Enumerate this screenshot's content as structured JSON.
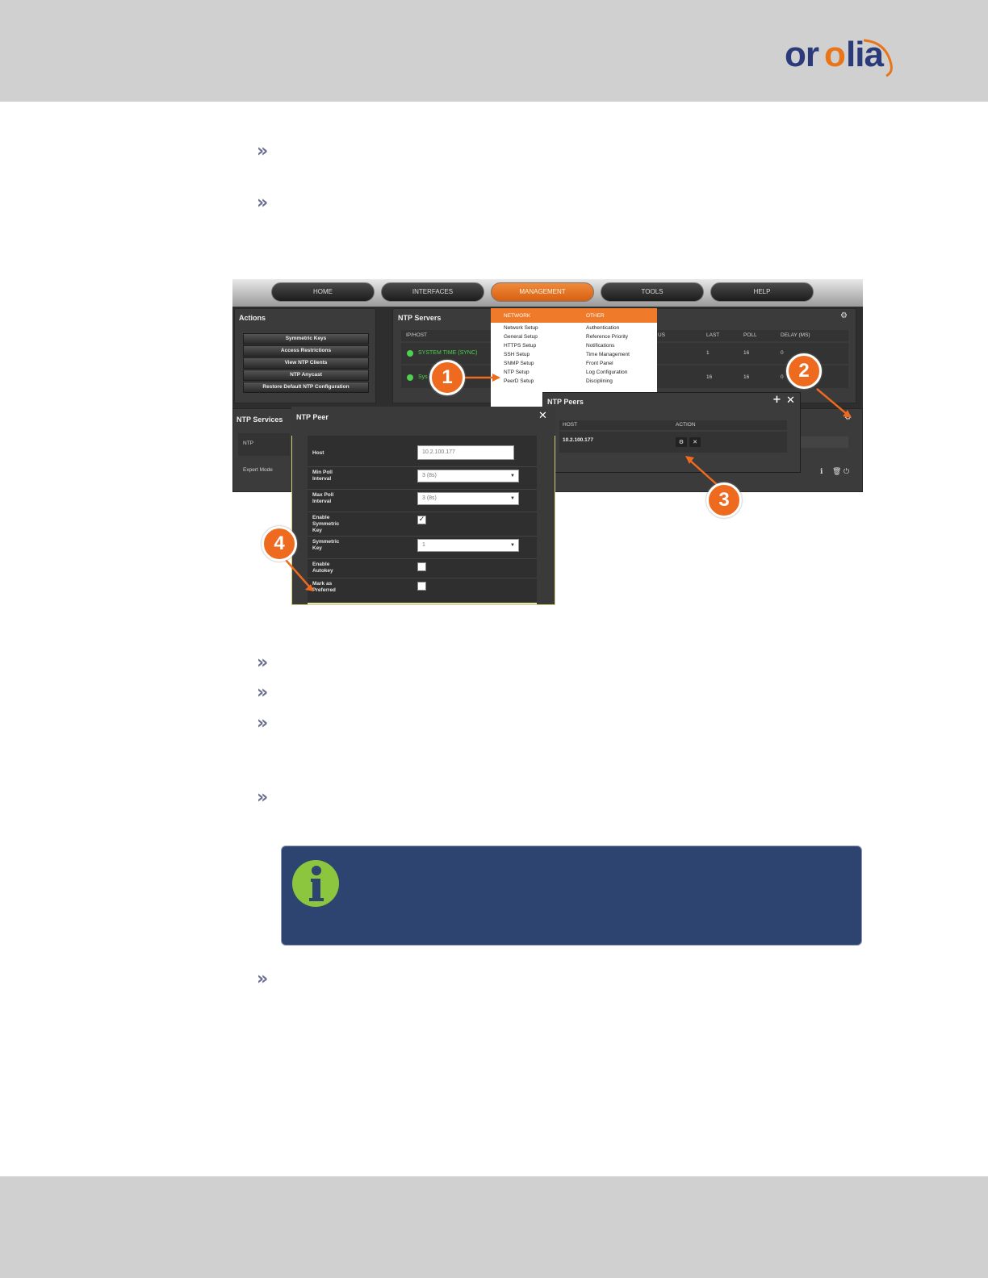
{
  "brand": {
    "logo_text": "orolia",
    "logo_colors": {
      "primary": "#2b3a7a",
      "accent": "#e8751a"
    }
  },
  "bullets": {
    "icon": "double-chevron-right-icon",
    "glyph": "»"
  },
  "screenshot": {
    "nav": [
      "HOME",
      "INTERFACES",
      "MANAGEMENT",
      "TOOLS",
      "HELP"
    ],
    "nav_active": "MANAGEMENT",
    "actions_panel": {
      "title": "Actions",
      "buttons": [
        "Symmetric Keys",
        "Access Restrictions",
        "View NTP Clients",
        "NTP Anycast",
        "Restore Default NTP Configuration"
      ]
    },
    "ntp_servers": {
      "title": "NTP Servers",
      "columns": [
        "IP/HOST",
        "US",
        "LAST",
        "POLL",
        "DELAY (MS)"
      ],
      "rows": [
        {
          "host": "SYSTEM TIME (SYNC)",
          "last": "1",
          "poll": "16",
          "delay": "0"
        },
        {
          "host": "Sys",
          "last": "16",
          "poll": "16",
          "delay": "0"
        }
      ]
    },
    "menu": {
      "network_header": "NETWORK",
      "other_header": "OTHER",
      "network": [
        "Network Setup",
        "General Setup",
        "HTTPS Setup",
        "SSH Setup",
        "SNMP Setup",
        "NTP Setup",
        "PeerD Setup"
      ],
      "other": [
        "Authentication",
        "Reference Priority",
        "Notifications",
        "Time Management",
        "Front Panel",
        "Log Configuration",
        "Disciplining"
      ]
    },
    "ntp_services": {
      "title": "NTP Services",
      "rows": [
        "NTP",
        "Expert Mode"
      ]
    },
    "ntp_peers": {
      "title": "NTP Peers",
      "columns": [
        "HOST",
        "ACTION"
      ],
      "rows": [
        {
          "host": "10.2.100.177"
        }
      ]
    },
    "ntp_peer_form": {
      "title": "NTP Peer",
      "host_label": "Host",
      "host_value": "10.2.100.177",
      "min_poll_label": "Min Poll Interval",
      "min_poll_value": "3 (8s)",
      "max_poll_label": "Max Poll Interval",
      "max_poll_value": "3 (8s)",
      "enable_sym_label": "Enable Symmetric Key",
      "enable_sym_checked": true,
      "sym_key_label": "Symmetric Key",
      "sym_key_value": "1",
      "autokey_label": "Enable Autokey",
      "preferred_label": "Mark as Preferred"
    },
    "callouts": [
      "1",
      "2",
      "3",
      "4"
    ],
    "callout_color": "#ee6a1e"
  },
  "note": {
    "icon": "info-icon",
    "bg_color": "#2d4470",
    "icon_color": "#8cc63f"
  }
}
